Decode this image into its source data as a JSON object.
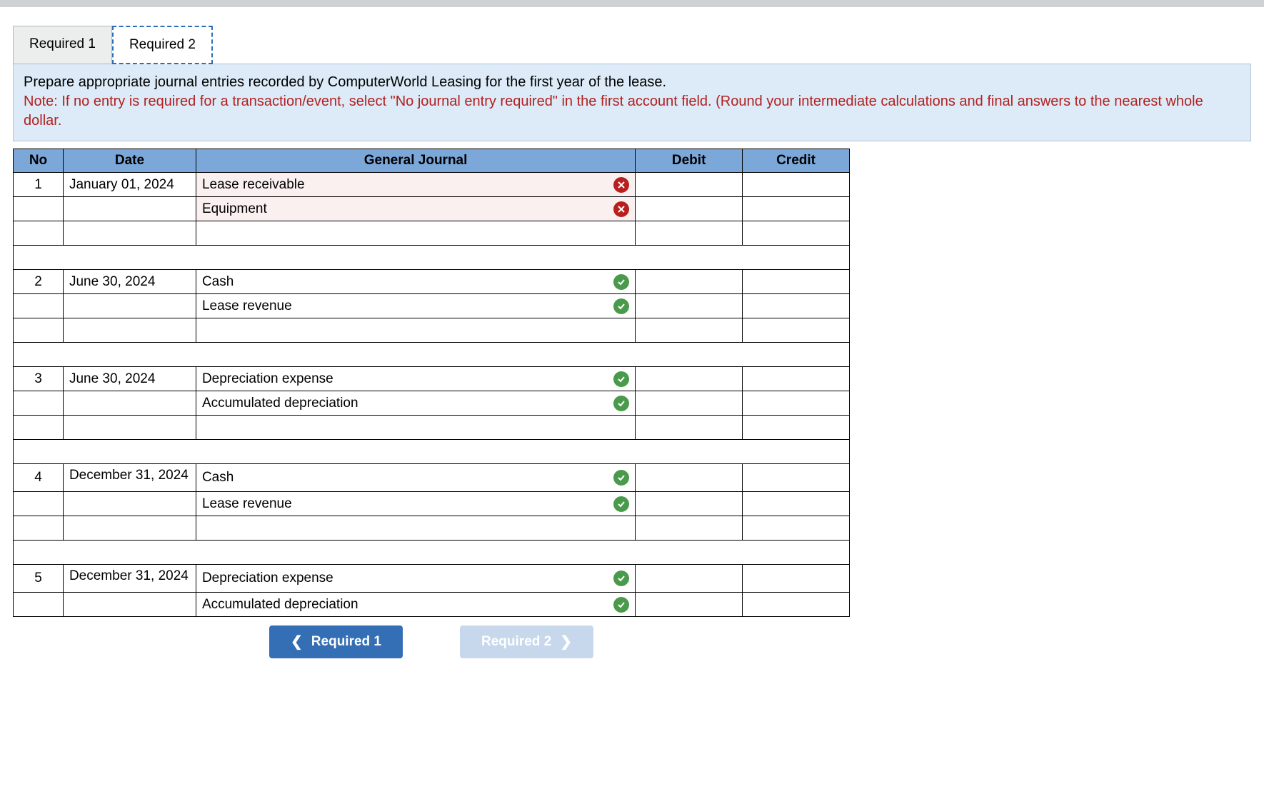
{
  "tabs": {
    "req1": "Required 1",
    "req2": "Required 2"
  },
  "instructions": {
    "line1": "Prepare appropriate journal entries recorded by ComputerWorld Leasing for the first year of the lease.",
    "note": "Note: If no entry is required for a transaction/event, select \"No journal entry required\" in the first account field. (Round your intermediate calculations and final answers to the nearest whole dollar."
  },
  "headers": {
    "no": "No",
    "date": "Date",
    "gj": "General Journal",
    "debit": "Debit",
    "credit": "Credit"
  },
  "entries": {
    "e1": {
      "no": "1",
      "date": "January 01, 2024",
      "line1": "Lease receivable",
      "line2": "Equipment",
      "s1": "bad",
      "s2": "bad"
    },
    "e2": {
      "no": "2",
      "date": "June 30, 2024",
      "line1": "Cash",
      "line2": "Lease revenue",
      "s1": "ok",
      "s2": "ok"
    },
    "e3": {
      "no": "3",
      "date": "June 30, 2024",
      "line1": "Depreciation expense",
      "line2": "Accumulated depreciation",
      "s1": "ok",
      "s2": "ok"
    },
    "e4": {
      "no": "4",
      "date": "December 31, 2024",
      "line1": "Cash",
      "line2": "Lease revenue",
      "s1": "ok",
      "s2": "ok"
    },
    "e5": {
      "no": "5",
      "date": "December 31, 2024",
      "line1": "Depreciation expense",
      "line2": "Accumulated depreciation",
      "s1": "ok",
      "s2": "ok"
    }
  },
  "nav": {
    "prev": "Required 1",
    "next": "Required 2"
  }
}
